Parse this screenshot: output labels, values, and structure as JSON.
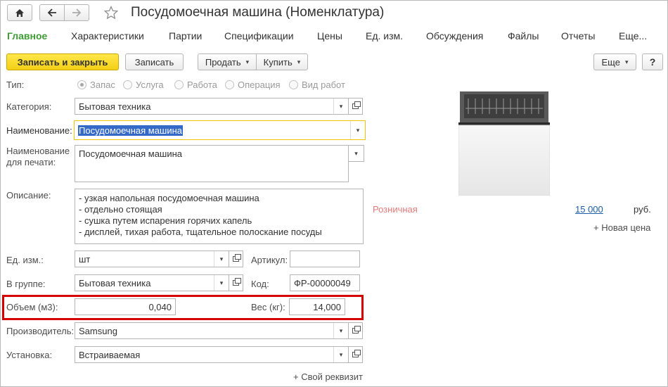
{
  "window": {
    "title": "Посудомоечная машина (Номенклатура)"
  },
  "tabs": [
    "Главное",
    "Характеристики",
    "Партии",
    "Спецификации",
    "Цены",
    "Ед. изм.",
    "Обсуждения",
    "Файлы",
    "Отчеты",
    "Еще..."
  ],
  "toolbar": {
    "save_close": "Записать и закрыть",
    "save": "Записать",
    "sell": "Продать",
    "buy": "Купить",
    "more": "Еще"
  },
  "type": {
    "label": "Тип:",
    "options": [
      "Запас",
      "Услуга",
      "Работа",
      "Операция",
      "Вид работ"
    ],
    "selected": "Запас"
  },
  "category": {
    "label": "Категория:",
    "value": "Бытовая техника"
  },
  "name": {
    "label": "Наименование:",
    "value": "Посудомоечная машина"
  },
  "print_name": {
    "label_line1": "Наименование",
    "label_line2": "для печати:",
    "value": "Посудомоечная машина"
  },
  "description": {
    "label": "Описание:",
    "lines": [
      "- узкая напольная посудомоечная машина",
      "- отдельно стоящая",
      "- сушка путем испарения горячих капель",
      "- дисплей, тихая работа, тщательное полоскание посуды"
    ]
  },
  "unit": {
    "label": "Ед. изм.:",
    "value": "шт"
  },
  "article": {
    "label": "Артикул:",
    "value": ""
  },
  "group": {
    "label": "В группе:",
    "value": "Бытовая техника"
  },
  "code": {
    "label": "Код:",
    "value": "ФР-00000049"
  },
  "volume": {
    "label": "Объем (м3):",
    "value": "0,040"
  },
  "weight": {
    "label": "Вес (кг):",
    "value": "14,000"
  },
  "manufacturer": {
    "label": "Производитель:",
    "value": "Samsung"
  },
  "installation": {
    "label": "Установка:",
    "value": "Встраиваемая"
  },
  "custom_prop": "+ Свой реквизит",
  "price": {
    "kind": "Розничная",
    "value": "15 000",
    "currency": "руб.",
    "new_price": "+ Новая цена"
  },
  "colors": {
    "accent_green": "#3f9c35",
    "highlight_red": "#d50000",
    "focus_yellow": "#f2c300",
    "selection_blue": "#3569c8"
  }
}
